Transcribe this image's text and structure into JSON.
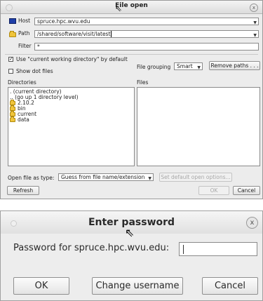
{
  "file_open": {
    "title": "File open",
    "host_label": "Host",
    "host_value": "spruce.hpc.wvu.edu",
    "path_label": "Path",
    "path_value": "/shared/software/visit/latest",
    "filter_label": "Filter",
    "filter_value": "*",
    "use_cwd_label": "Use \"current working directory\" by default",
    "use_cwd_checked": "✓",
    "show_dot_label": "Show dot files",
    "file_grouping_label": "File grouping",
    "file_grouping_value": "Smart",
    "remove_paths_label": "Remove paths . . .",
    "directories_label": "Directories",
    "files_label": "Files",
    "directories": [
      {
        "label": ". (current directory)"
      },
      {
        "label": ".. (go up 1 directory level)"
      },
      {
        "label": "2.10.2"
      },
      {
        "label": "bin"
      },
      {
        "label": "current"
      },
      {
        "label": "data"
      }
    ],
    "open_as_label": "Open file as type:",
    "open_as_value": "Guess from file name/extension",
    "set_default_label": "Set default open options...",
    "refresh_label": "Refresh",
    "ok_label": "OK",
    "cancel_label": "Cancel",
    "close_glyph": "x"
  },
  "password": {
    "title": "Enter password",
    "prompt": "Password for spruce.hpc.wvu.edu:",
    "ok_label": "OK",
    "change_username_label": "Change username",
    "cancel_label": "Cancel",
    "close_glyph": "x"
  },
  "icons": {
    "dropdown": "▼",
    "pointer": "⇖"
  }
}
